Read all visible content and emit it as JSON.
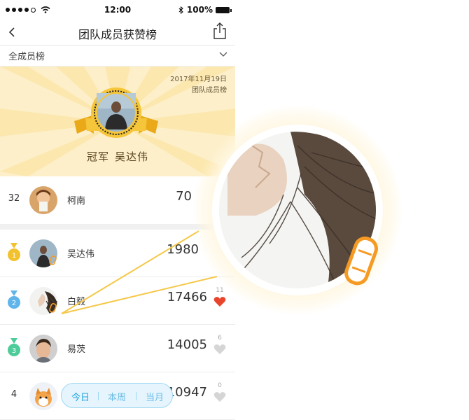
{
  "status_bar": {
    "time": "12:00",
    "battery": "100%"
  },
  "nav": {
    "title": "团队成员获赞榜"
  },
  "filter": {
    "label": "全成员榜"
  },
  "hero": {
    "date": "2017年11月19日",
    "subtitle": "团队成员榜",
    "champion_label": "冠军",
    "champion_name": "吴达伟"
  },
  "my_row": {
    "rank": "32",
    "name": "柯南",
    "score": "70"
  },
  "rows": [
    {
      "rank": "1",
      "name": "吴达伟",
      "score": "1980",
      "medal": "gold"
    },
    {
      "rank": "2",
      "name": "白毅",
      "score": "17466",
      "likes": "11",
      "liked": true,
      "medal": "blue"
    },
    {
      "rank": "3",
      "name": "易茨",
      "score": "14005",
      "likes": "6",
      "liked": false,
      "medal": "green"
    },
    {
      "rank": "4",
      "name": "",
      "score": "10947",
      "likes": "0",
      "liked": false
    }
  ],
  "time_tabs": {
    "today": "今日",
    "week": "本周",
    "month": "当月",
    "selected": "今日"
  },
  "colors": {
    "accent_blue": "#1ca2e1",
    "gold": "#f2c12e",
    "hero_bg": "#fcefc9",
    "heart_red": "#e8452c",
    "heart_gray": "#d5d5d5"
  }
}
